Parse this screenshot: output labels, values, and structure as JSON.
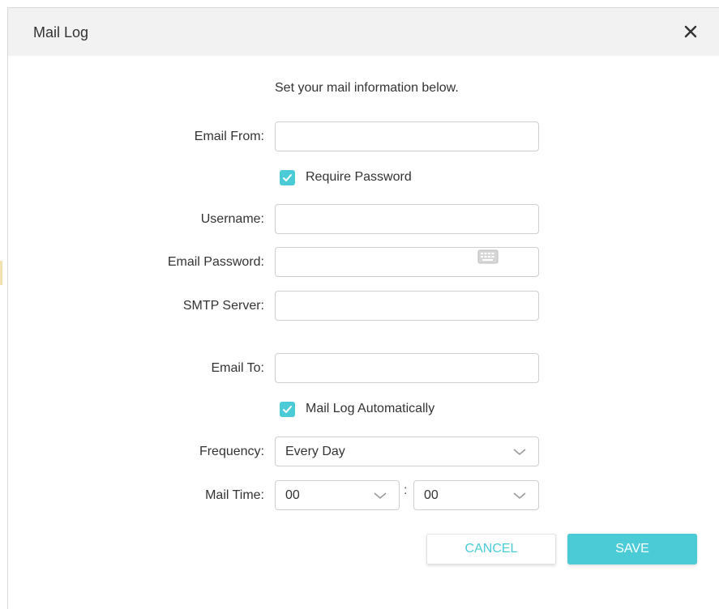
{
  "dialog": {
    "title": "Mail Log",
    "intro": "Set your mail information below."
  },
  "form": {
    "email_from": {
      "label": "Email From:",
      "value": ""
    },
    "require_password": {
      "label": "Require Password",
      "checked": true
    },
    "username": {
      "label": "Username:",
      "value": ""
    },
    "email_password": {
      "label": "Email Password:",
      "value": ""
    },
    "smtp_server": {
      "label": "SMTP Server:",
      "value": ""
    },
    "email_to": {
      "label": "Email To:",
      "value": ""
    },
    "mail_log_auto": {
      "label": "Mail Log Automatically",
      "checked": true
    },
    "frequency": {
      "label": "Frequency:",
      "value": "Every Day"
    },
    "mail_time": {
      "label": "Mail Time:",
      "hour": "00",
      "separator": ":",
      "minute": "00"
    }
  },
  "buttons": {
    "cancel": "CANCEL",
    "save": "SAVE"
  },
  "colors": {
    "accent": "#4acbd6",
    "header_bg": "#f2f2f2"
  },
  "icons": {
    "close": "close-icon",
    "keyboard": "keyboard-icon",
    "check": "checkmark-icon",
    "chevron": "chevron-down-icon"
  }
}
